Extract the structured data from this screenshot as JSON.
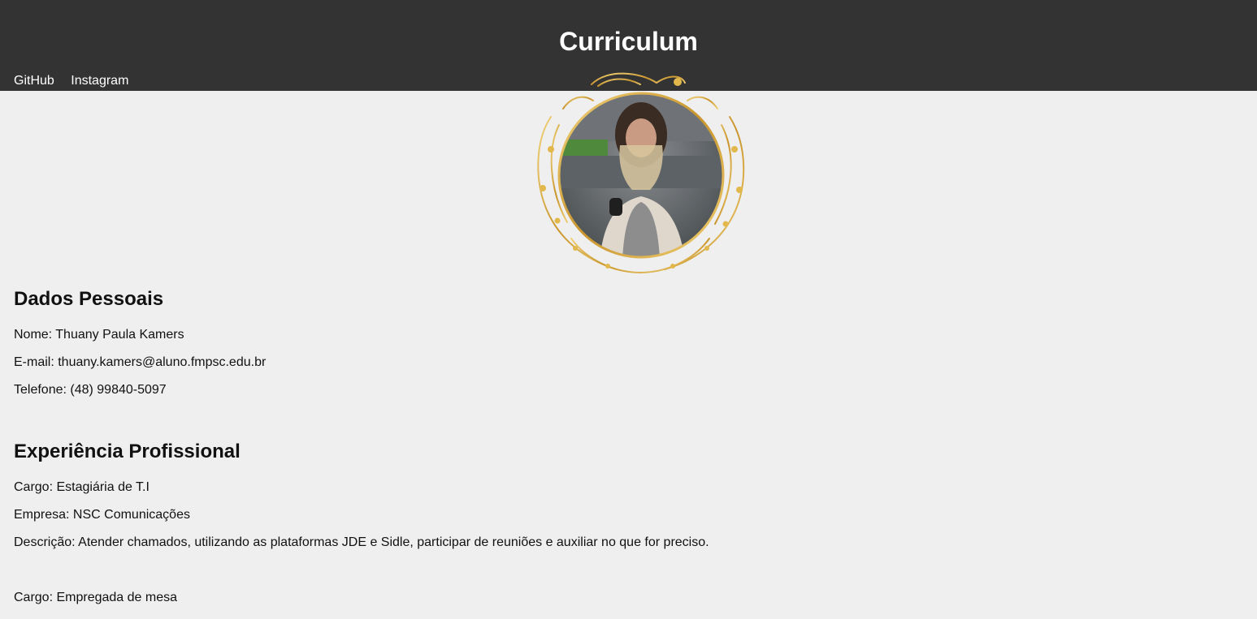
{
  "header": {
    "title": "Curriculum",
    "nav": [
      "GitHub",
      "Instagram"
    ]
  },
  "profile_photo": {
    "frame_color": "#d4a630"
  },
  "personal": {
    "heading": "Dados Pessoais",
    "name": "Nome: Thuany Paula Kamers",
    "email": "E-mail: thuany.kamers@aluno.fmpsc.edu.br",
    "phone": "Telefone: (48) 99840-5097"
  },
  "experience": {
    "heading": "Experiência Profissional",
    "jobs": [
      {
        "role": "Cargo: Estagiária de T.I",
        "company": "Empresa: NSC Comunicações",
        "description": "Descrição: Atender chamados, utilizando as plataformas JDE e Sidle, participar de reuniões e auxiliar no que for preciso."
      },
      {
        "role": "Cargo: Empregada de mesa"
      }
    ]
  },
  "colors": {
    "header_bg": "#333333",
    "page_bg": "#efefef",
    "header_text": "#ffffff"
  }
}
